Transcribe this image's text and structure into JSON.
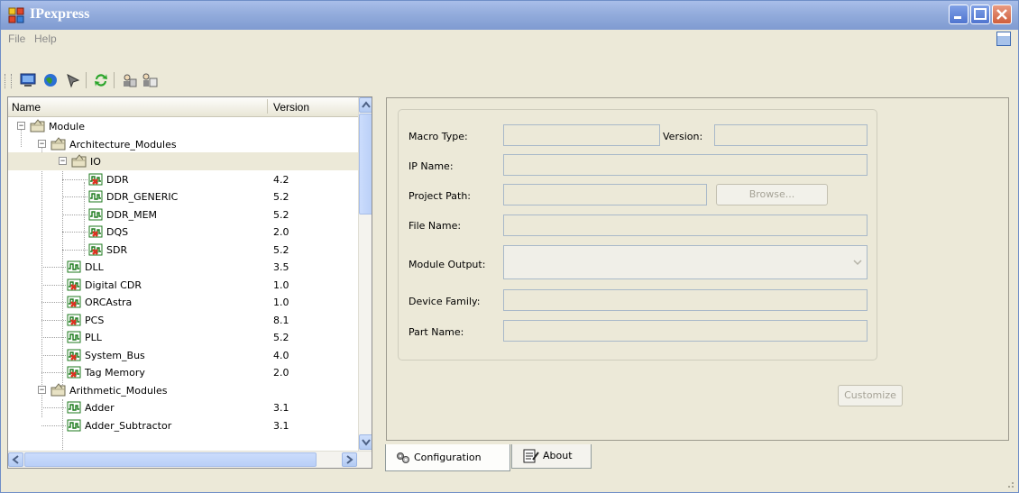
{
  "window": {
    "title": "IPexpress"
  },
  "menu": [
    {
      "label": "File"
    },
    {
      "label": "Help"
    }
  ],
  "toolbar": {
    "icons": [
      "monitor-icon",
      "globe-icon",
      "arrow-tool-icon",
      "refresh-icon",
      "users-icon",
      "user-list-icon"
    ]
  },
  "tree": {
    "headers": {
      "name": "Name",
      "version": "Version"
    },
    "rows": [
      {
        "label": "Module",
        "version": "",
        "level": 0,
        "type": "folder",
        "expander": "−"
      },
      {
        "label": "Architecture_Modules",
        "version": "",
        "level": 1,
        "type": "folder",
        "expander": "−"
      },
      {
        "label": "IO",
        "version": "",
        "level": 2,
        "type": "folder",
        "expander": "−",
        "selected": true
      },
      {
        "label": "DDR",
        "version": "4.2",
        "level": 3,
        "type": "module-x"
      },
      {
        "label": "DDR_GENERIC",
        "version": "5.2",
        "level": 3,
        "type": "module"
      },
      {
        "label": "DDR_MEM",
        "version": "5.2",
        "level": 3,
        "type": "module"
      },
      {
        "label": "DQS",
        "version": "2.0",
        "level": 3,
        "type": "module-x"
      },
      {
        "label": "SDR",
        "version": "5.2",
        "level": 3,
        "type": "module-x"
      },
      {
        "label": "DLL",
        "version": "3.5",
        "level": 2,
        "type": "module"
      },
      {
        "label": "Digital CDR",
        "version": "1.0",
        "level": 2,
        "type": "module-x"
      },
      {
        "label": "ORCAstra",
        "version": "1.0",
        "level": 2,
        "type": "module-x"
      },
      {
        "label": "PCS",
        "version": "8.1",
        "level": 2,
        "type": "module-x"
      },
      {
        "label": "PLL",
        "version": "5.2",
        "level": 2,
        "type": "module"
      },
      {
        "label": "System_Bus",
        "version": "4.0",
        "level": 2,
        "type": "module-x"
      },
      {
        "label": "Tag Memory",
        "version": "2.0",
        "level": 2,
        "type": "module-x"
      },
      {
        "label": "Arithmetic_Modules",
        "version": "",
        "level": 1,
        "type": "folder",
        "expander": "−"
      },
      {
        "label": "Adder",
        "version": "3.1",
        "level": 2,
        "type": "module"
      },
      {
        "label": "Adder_Subtractor",
        "version": "3.1",
        "level": 2,
        "type": "module"
      }
    ]
  },
  "form": {
    "macro_type_label": "Macro Type:",
    "version_label": "Version:",
    "ip_name_label": "IP Name:",
    "project_path_label": "Project Path:",
    "browse_label": "Browse...",
    "file_name_label": "File Name:",
    "module_output_label": "Module Output:",
    "device_family_label": "Device Family:",
    "part_name_label": "Part Name:",
    "customize_label": "Customize"
  },
  "tabs": [
    {
      "label": "Configuration"
    },
    {
      "label": "About"
    }
  ]
}
